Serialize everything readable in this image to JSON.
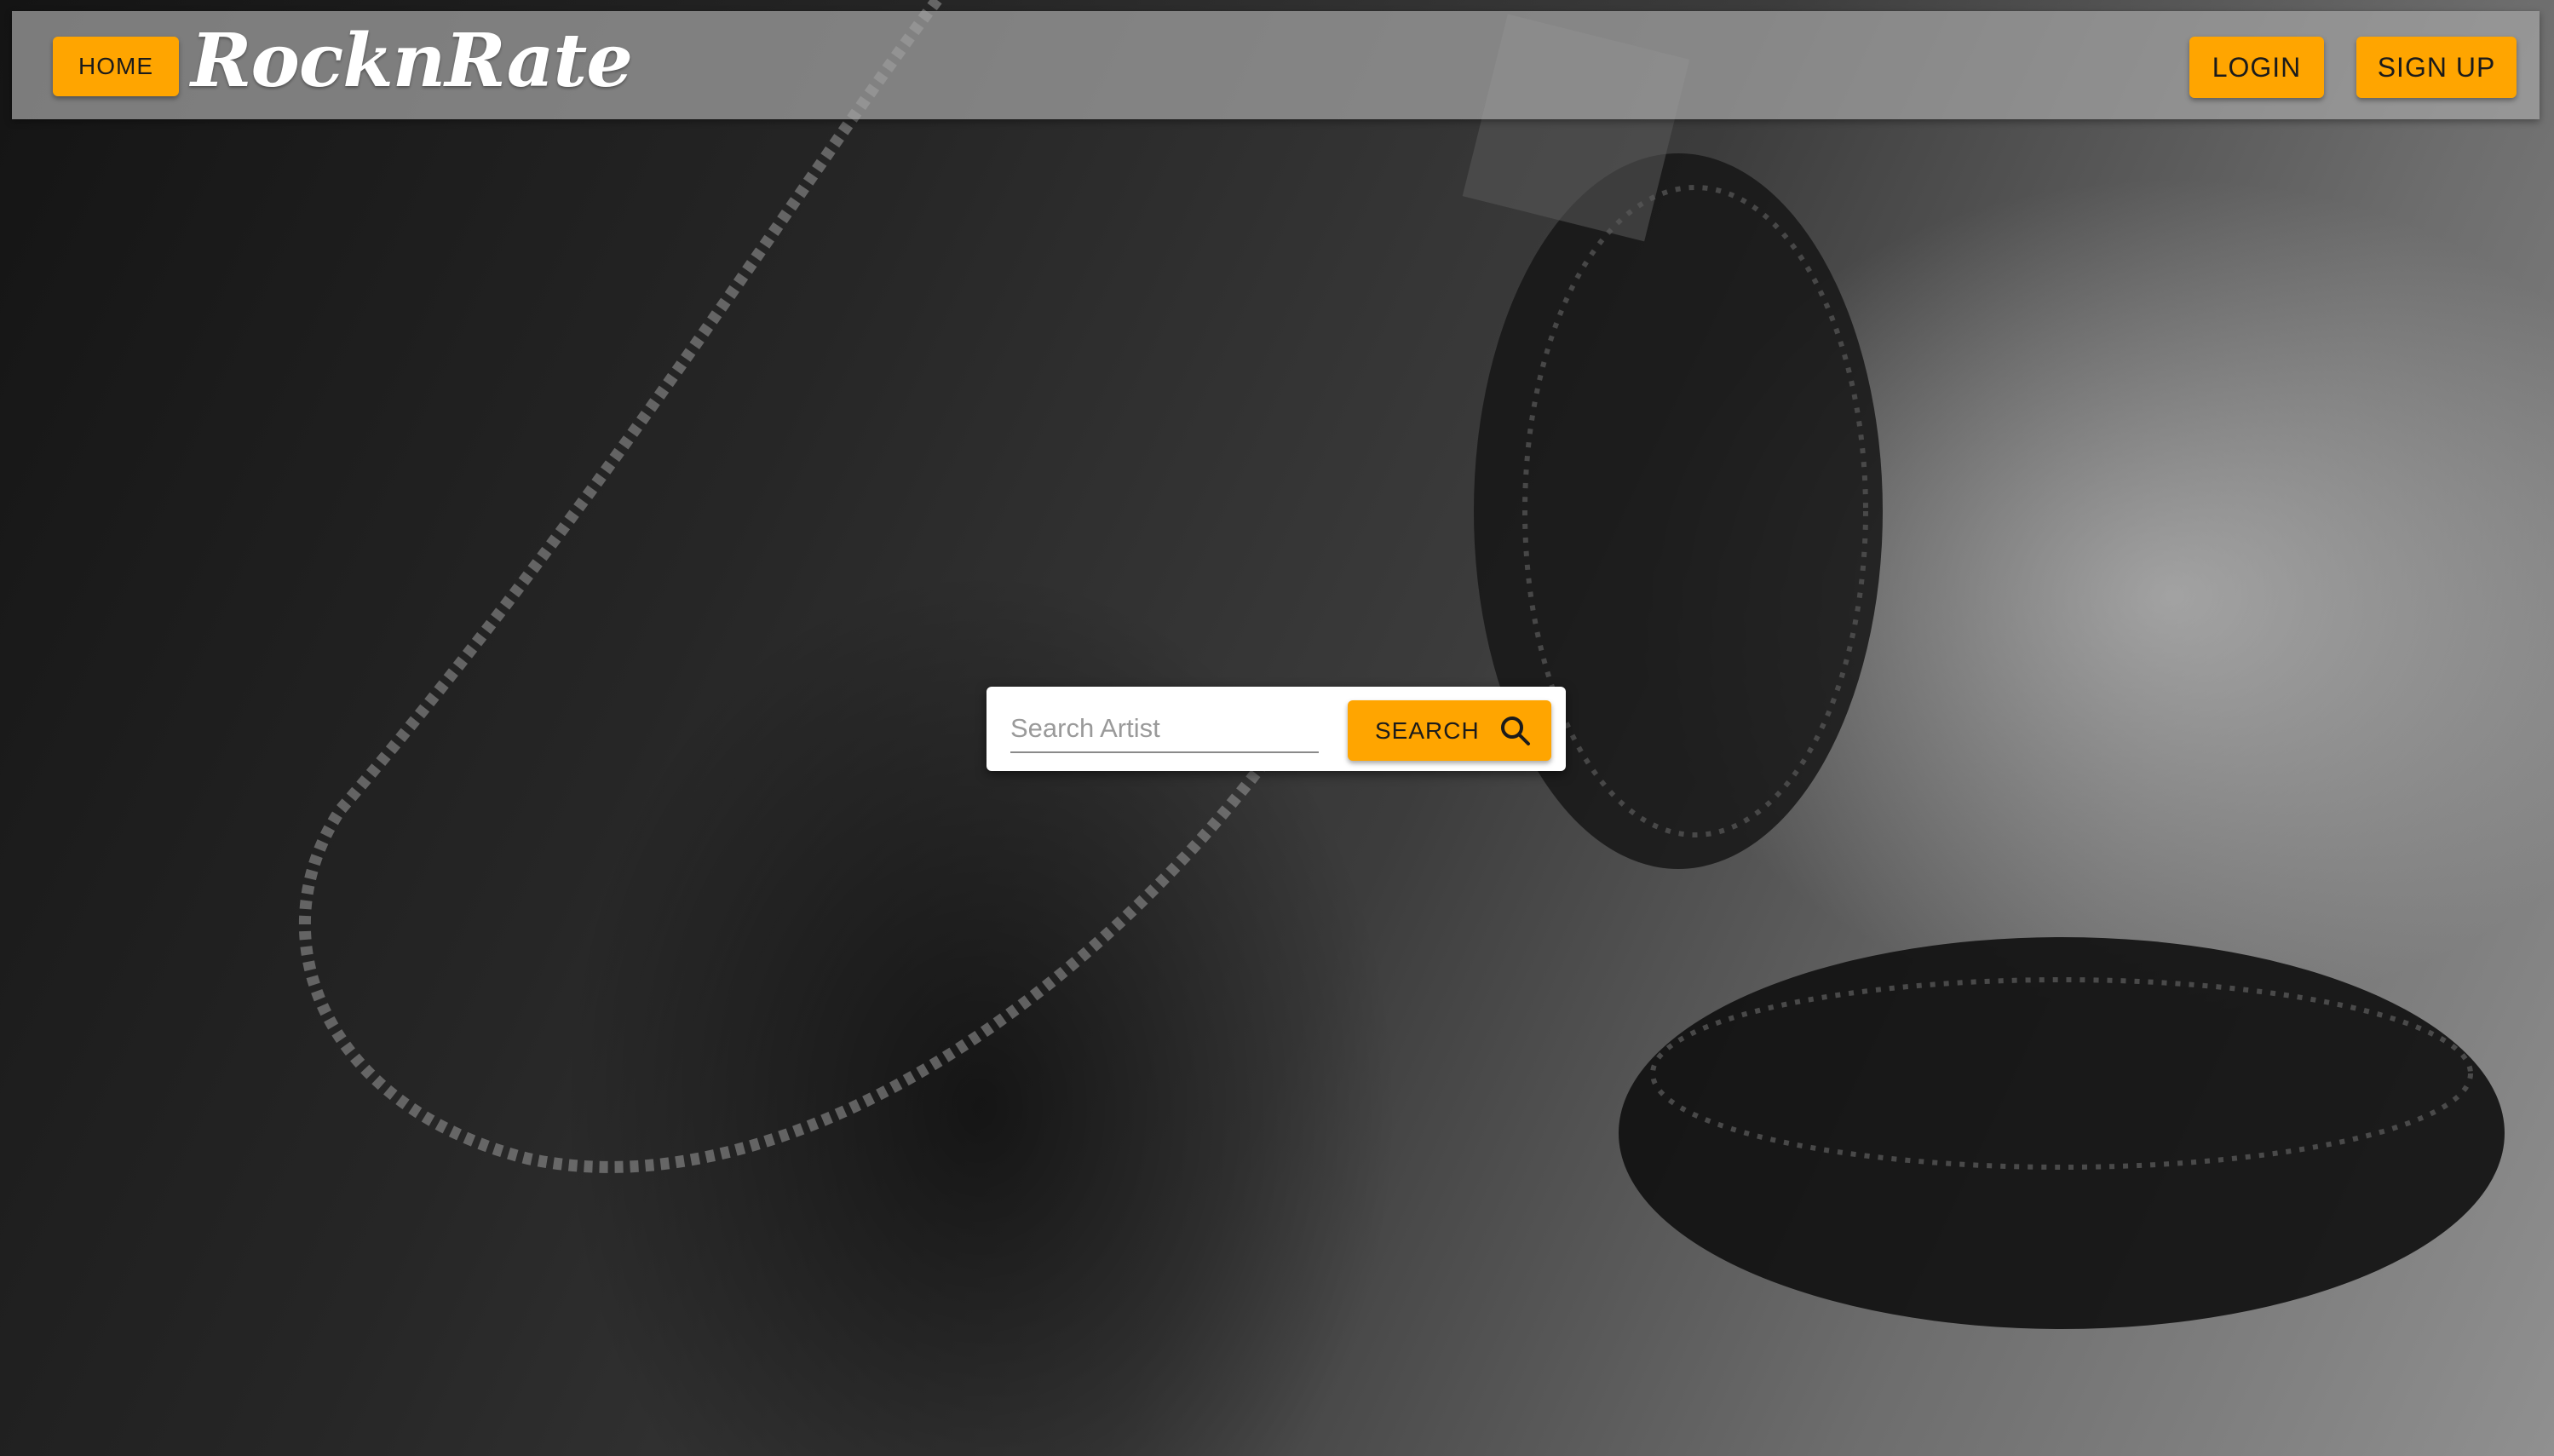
{
  "navbar": {
    "home_label": "HOME",
    "brand": "RocknRate",
    "login_label": "LOGIN",
    "signup_label": "SIGN UP"
  },
  "search": {
    "placeholder": "Search Artist",
    "value": "",
    "button_label": "SEARCH",
    "button_icon": "search-icon"
  },
  "colors": {
    "accent": "#ffa500",
    "navbar_bg": "rgba(165,165,165,0.72)",
    "card_bg": "#ffffff"
  }
}
